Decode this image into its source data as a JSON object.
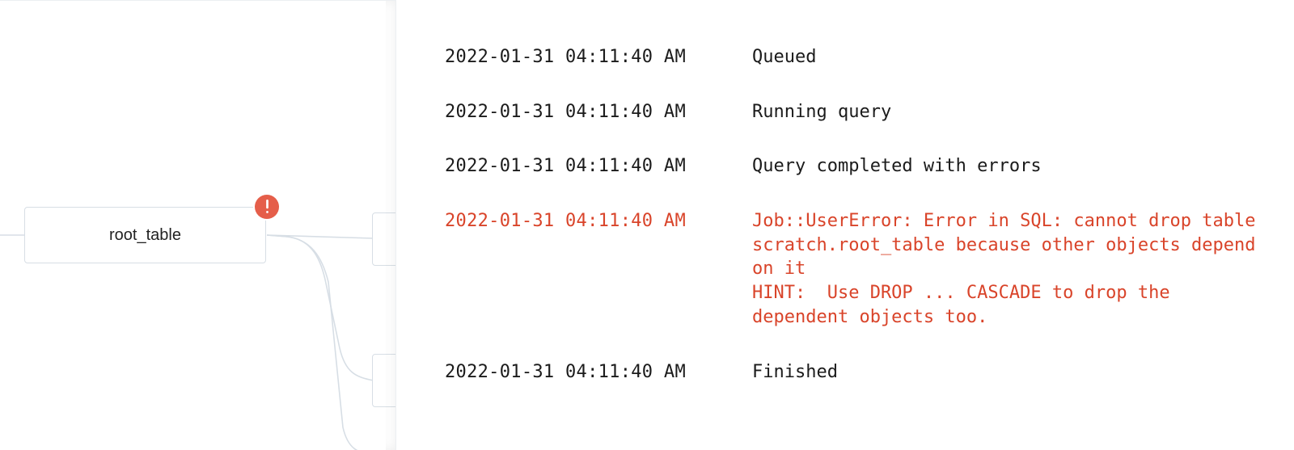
{
  "colors": {
    "error": "#d9442a",
    "node_border": "#d7dee5",
    "alert_bg": "#e55e4a"
  },
  "graph": {
    "main_node_label": "root_table",
    "alert_icon": "exclaim-icon"
  },
  "log": {
    "entries": [
      {
        "timestamp": "2022-01-31 04:11:40 AM",
        "message": "Queued",
        "error": false
      },
      {
        "timestamp": "2022-01-31 04:11:40 AM",
        "message": "Running query",
        "error": false
      },
      {
        "timestamp": "2022-01-31 04:11:40 AM",
        "message": "Query completed with errors",
        "error": false
      },
      {
        "timestamp": "2022-01-31 04:11:40 AM",
        "message": "Job::UserError: Error in SQL: cannot drop table scratch.root_table because other objects depend on it\nHINT:  Use DROP ... CASCADE to drop the dependent objects too.",
        "error": true
      },
      {
        "timestamp": "2022-01-31 04:11:40 AM",
        "message": "Finished",
        "error": false
      }
    ]
  }
}
